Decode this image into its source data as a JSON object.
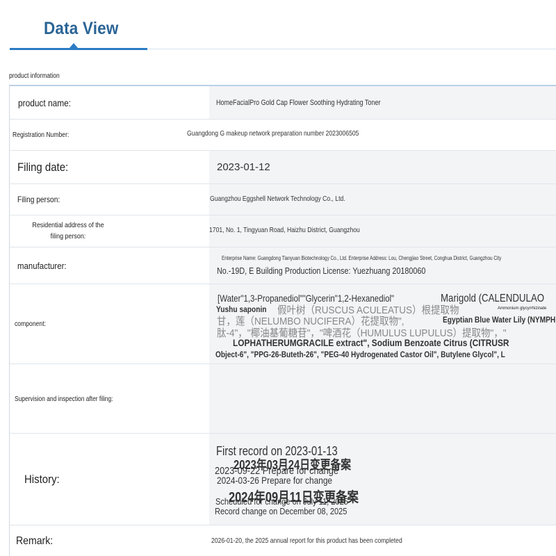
{
  "tab": {
    "title": "Data View"
  },
  "section": {
    "label": "product information"
  },
  "rows": {
    "product_name": {
      "label": "product name:",
      "value": "HomeFacialPro Gold Cap Flower Soothing Hydrating Toner"
    },
    "registration": {
      "label": "Registration Number:",
      "value": "Guangdong G makeup network preparation number 2023006505"
    },
    "filing_date": {
      "label": "Filing date:",
      "value": "2023-01-12"
    },
    "filing_person": {
      "label": "Filing person:",
      "value": "Guangzhou Eggshell Network Technology Co., Ltd."
    },
    "address": {
      "label_line1": "Residential address of the",
      "label_line2": "filing person:",
      "value": "1701, No. 1, Tingyuan Road, Haizhu District, Guangzhou"
    },
    "manufacturer": {
      "label": "manufacturer:",
      "value_line1": "Enterprise Name: Guangdong Tianyuan Biotechnology Co., Ltd. Enterprise Address: Lou, Chengjiao Street, Conghua District, Guangzhou City",
      "value_line2": "No.-19D, E Building Production License: Yuezhuang 20180060"
    },
    "component": {
      "label": "component:",
      "lines": [
        "[Water\"1,3-Propanediol\"\"Glycerin\"1,2-Hexanediol\"",
        "Marigold (CALENDULAO",
        "Yushu saponin",
        "假叶树（RUSCUS ACULEATUS）根提取物",
        "Ammonium glycyrrhizinate",
        "甘，莲（NELUMBO NUCIFERA）花提取物\",",
        "Egyptian Blue Water Lily (NYMPH",
        "肽-4\"，\"椰油基葡糖苷\"，\"啤酒花（HUMULUS LUPULUS）提取物\"，\"",
        "LOPHATHERUMGRACILE extract\", Sodium Benzoate Citrus (CITRUSR",
        "Object-6\", \"PPG-26-Buteth-26\", \"PEG-40 Hydrogenated Castor Oil\", Butylene Glycol\", L"
      ]
    },
    "supervision": {
      "label": "Supervision and inspection after filing:",
      "value": ""
    },
    "history": {
      "label": "History:",
      "lines": [
        "First record on 2023-01-13",
        "2023年03月24日变更备案",
        "2023-09-22 Prepare for change",
        "2024-03-26 Prepare for change",
        "2024年09月11日变更备案",
        "Scheduled for change on July 11, 2025",
        "Record change on December 08, 2025"
      ]
    },
    "remark": {
      "label": "Remark:",
      "value": "2026-01-20, the 2025 annual report for this product has been completed"
    }
  }
}
